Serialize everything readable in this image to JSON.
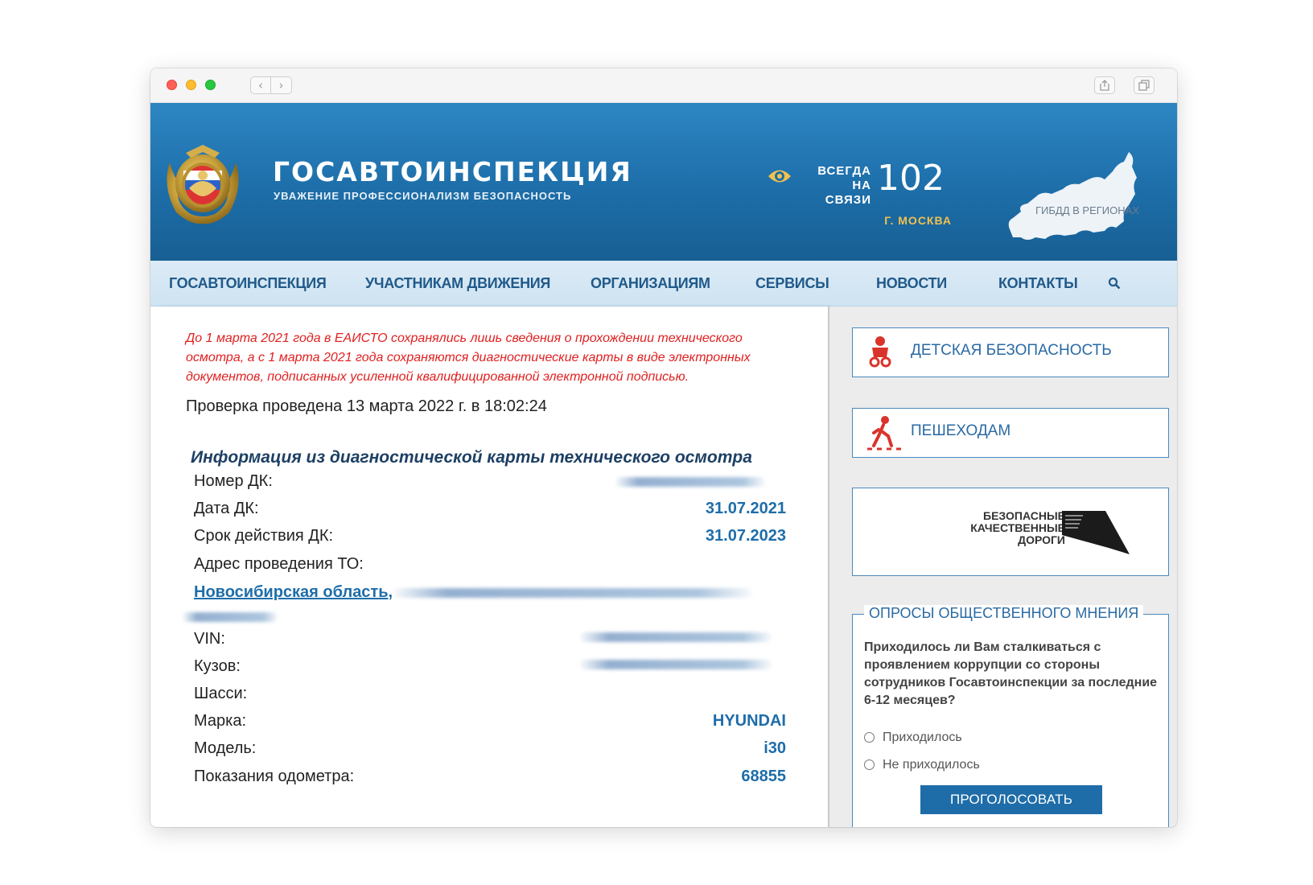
{
  "header": {
    "title": "ГОСАВТОИНСПЕКЦИЯ",
    "subtitle": "УВАЖЕНИЕ ПРОФЕССИОНАЛИЗМ БЕЗОПАСНОСТЬ",
    "always_line1": "ВСЕГДА",
    "always_line2": "НА СВЯЗИ",
    "phone": "102",
    "city": "Г. МОСКВА",
    "regions_label": "ГИБДД В РЕГИОНАХ",
    "accessibility_icon": "eye-icon"
  },
  "menu": {
    "items": [
      "ГОСАВТОИНСПЕКЦИЯ",
      "УЧАСТНИКАМ ДВИЖЕНИЯ",
      "ОРГАНИЗАЦИЯМ",
      "СЕРВИСЫ",
      "НОВОСТИ",
      "КОНТАКТЫ"
    ],
    "search_icon": "search-icon"
  },
  "main": {
    "notice": "До 1 марта 2021 года в ЕАИСТО сохранялись лишь сведения о прохождении технического осмотра, а с 1 марта 2021 года сохраняются диагностические карты в виде электронных документов, подписанных усиленной квалифицированной электронной подписью.",
    "check_date": "Проверка проведена 13 марта 2022 г. в 18:02:24",
    "section_title": "Информация из диагностической карты технического осмотра",
    "labels": {
      "dk_number": "Номер ДК:",
      "dk_date": "Дата ДК:",
      "dk_valid": "Срок действия ДК:",
      "address": "Адрес проведения ТО:",
      "vin": "VIN:",
      "body": "Кузов:",
      "chassis": "Шасси:",
      "brand": "Марка:",
      "model": "Модель:",
      "odometer": "Показания одометра:"
    },
    "values": {
      "dk_date": "31.07.2021",
      "dk_valid": "31.07.2023",
      "address": "Новосибирская область,",
      "brand": "HYUNDAI",
      "model": "i30",
      "odometer": "68855"
    }
  },
  "sidebar": {
    "child_safety": "ДЕТСКАЯ БЕЗОПАСНОСТЬ",
    "pedestrians": "ПЕШЕХОДАМ",
    "bkd_line1": "БЕЗОПАСНЫЕ",
    "bkd_line2": "КАЧЕСТВЕННЫЕ ДОРОГИ",
    "poll": {
      "legend": "ОПРОСЫ ОБЩЕСТВЕННОГО МНЕНИЯ",
      "question": "Приходилось ли Вам сталкиваться с проявлением коррупции со стороны сотрудников Госавтоинспекции за последние 6-12 месяцев?",
      "options": [
        "Приходилось",
        "Не приходилось"
      ],
      "vote_button": "ПРОГОЛОСОВАТЬ"
    }
  },
  "colors": {
    "header_blue": "#1d6ea9",
    "menu_bg": "#d6e8f5",
    "link_blue": "#1e6da9",
    "notice_red": "#e02020",
    "city_gold": "#f2c14e"
  }
}
